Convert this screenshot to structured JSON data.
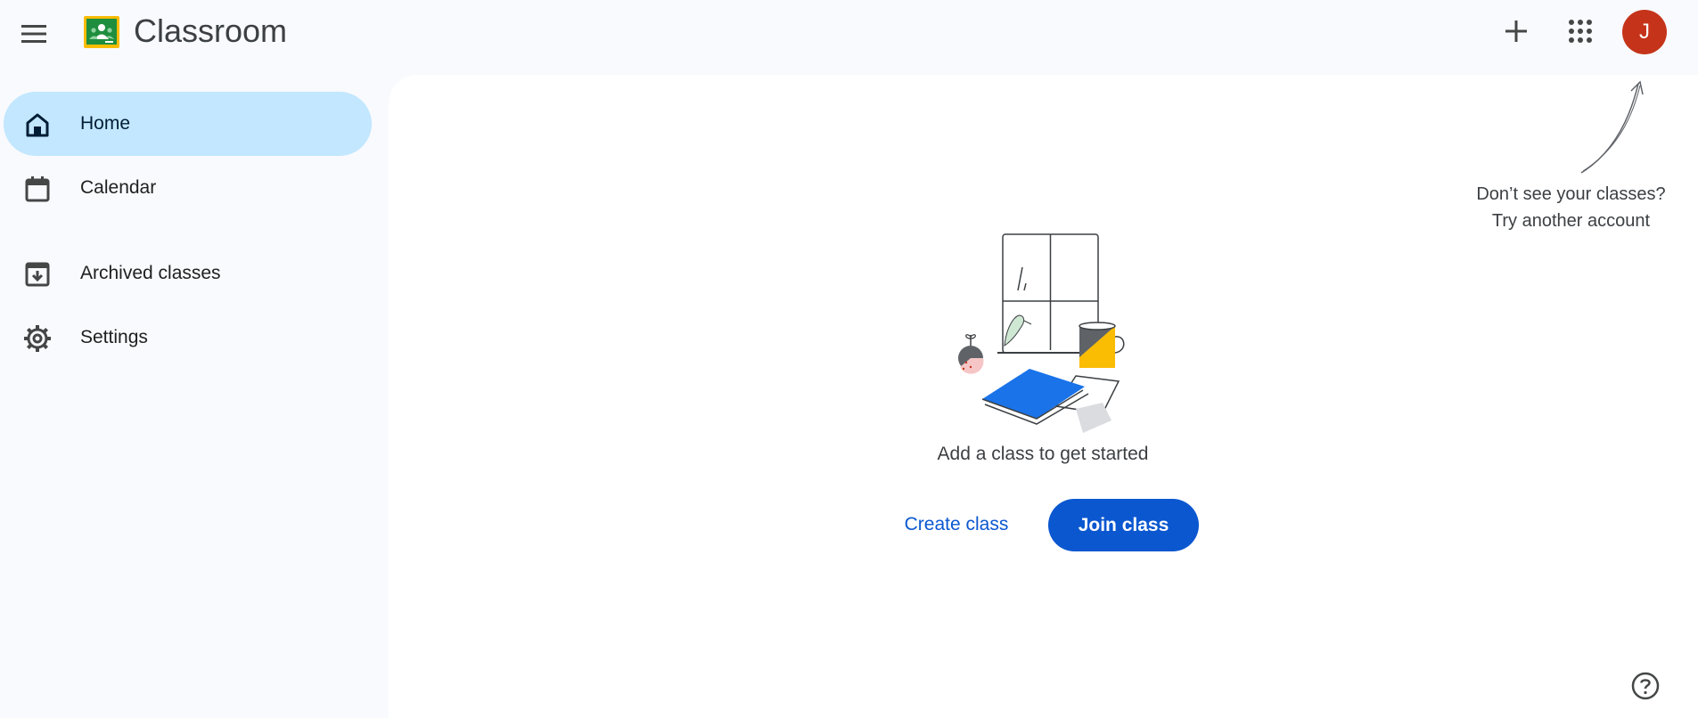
{
  "app": {
    "title": "Classroom",
    "menu_icon": "hamburger-menu-icon",
    "logo_icon": "google-classroom-logo",
    "brand_color": "#1e8e3e"
  },
  "header": {
    "create_icon": "plus-icon",
    "apps_icon": "google-apps-grid-icon",
    "avatar_initial": "J",
    "avatar_color": "#c5341a"
  },
  "sidebar": {
    "items": [
      {
        "label": "Home",
        "icon": "home-icon",
        "active": true
      },
      {
        "label": "Calendar",
        "icon": "calendar-icon",
        "active": false
      },
      {
        "label": "Archived classes",
        "icon": "archive-icon",
        "active": false
      },
      {
        "label": "Settings",
        "icon": "gear-icon",
        "active": false
      }
    ],
    "active_color": "#c2e7ff"
  },
  "main": {
    "hint_line1": "Don’t see your classes?",
    "hint_line2": "Try another account",
    "empty_message": "Add a class to get started",
    "create_label": "Create class",
    "join_label": "Join class",
    "accent_color": "#0b57d0",
    "help_icon": "help-circle-icon"
  }
}
